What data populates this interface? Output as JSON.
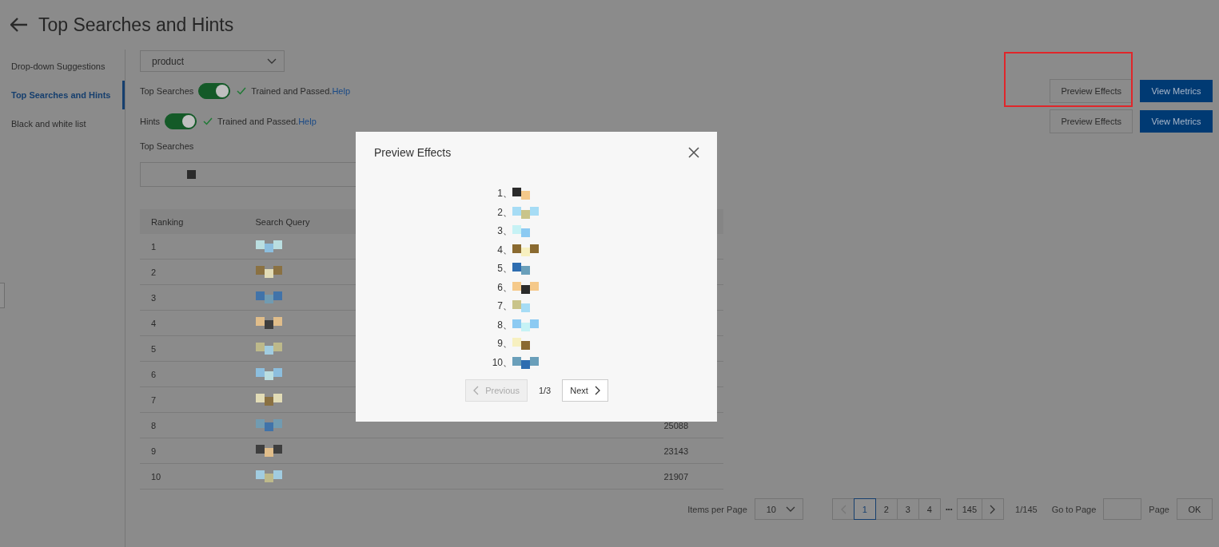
{
  "page": {
    "title": "Top Searches and Hints"
  },
  "sidebar": {
    "items": [
      {
        "label": "Drop-down Suggestions",
        "selected": false
      },
      {
        "label": "Top Searches and Hints",
        "selected": true
      },
      {
        "label": "Black and white list",
        "selected": false
      }
    ]
  },
  "index_select": {
    "value": "product"
  },
  "feature_rows": [
    {
      "label": "Top Searches",
      "on": true,
      "status": "Trained and Passed.",
      "link": "Help",
      "preview_button": "Preview Effects",
      "metrics_button": "View Metrics",
      "highlighted": true
    },
    {
      "label": "Hints",
      "on": true,
      "status": "Trained and Passed.",
      "link": "Help",
      "preview_button": "Preview Effects",
      "metrics_button": "View Metrics"
    }
  ],
  "section_title": "Top Searches",
  "table": {
    "columns": [
      "Ranking",
      "Search Query"
    ],
    "rows": [
      {
        "ranking": "1"
      },
      {
        "ranking": "2"
      },
      {
        "ranking": "3"
      },
      {
        "ranking": "4"
      },
      {
        "ranking": "5"
      },
      {
        "ranking": "6"
      },
      {
        "ranking": "7"
      },
      {
        "ranking": "8",
        "column_3": "25088"
      },
      {
        "ranking": "9",
        "column_3": "23143"
      },
      {
        "ranking": "10",
        "column_3": "21907"
      }
    ]
  },
  "pagination": {
    "items_per_page_label": "Items per Page",
    "page_size": "10",
    "pages": [
      {
        "kind": "page",
        "label": "1",
        "selected": true
      },
      {
        "kind": "page",
        "label": "2",
        "selected": false
      },
      {
        "kind": "page",
        "label": "3",
        "selected": false
      },
      {
        "kind": "page",
        "label": "4",
        "selected": false
      },
      {
        "kind": "ellipsis",
        "label": "•••"
      },
      {
        "kind": "page",
        "label": "145",
        "selected": false
      }
    ],
    "summary": "1/145",
    "goto_label": "Go to Page",
    "page_suffix": "Page",
    "ok_button": "OK"
  },
  "dialog": {
    "title": "Preview Effects",
    "items": [
      "1、",
      "2、",
      "3、",
      "4、",
      "5、",
      "6、",
      "7、",
      "8、",
      "9、",
      "10、"
    ],
    "previous": {
      "label": "Previous",
      "disabled": true
    },
    "counter": "1/3",
    "next": {
      "label": "Next",
      "disabled": false
    }
  }
}
